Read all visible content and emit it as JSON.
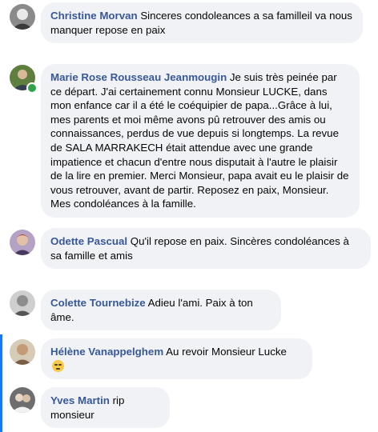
{
  "comments": [
    {
      "author": "Christine Morvan",
      "text": "Sinceres condoleances a sa familleil va nous manquer repose en paix",
      "online": false
    },
    {
      "author": "Marie Rose Rousseau Jeanmougin",
      "text": "Je suis très peinée par ce départ. J'ai certainement connu Monsieur LUCKE, dans mon enfance car il a été le coéquipier de papa...Grâce à lui, mes parents et moi même avons pû retrouver des amis ou connaissances, perdus de vue depuis si longtemps. La revue de SALA MARRAKECH était attendue avec une grande impatience et chacun d'entre nous disputait à l'autre le plaisir de la lire en premier. Merci Monsieur, papa avait eu le plaisir de vous retrouver, avant de partir. Reposez en paix, Monsieur. Mes condoléances à la famille.",
      "online": true
    },
    {
      "author": "Odette Pascual",
      "text": "Qu'il repose en paix. Sincères condoléances à sa famille et amis",
      "online": false
    },
    {
      "author": "Colette Tournebize",
      "text": "Adieu l'ami. Paix à ton âme.",
      "online": false
    },
    {
      "author": "Hélène Vanappelghem",
      "text": "Au revoir Monsieur Lucke",
      "emoji": "sad-face-emoji",
      "online": false,
      "highlighted": true
    },
    {
      "author": "Yves Martin",
      "text": "rip monsieur",
      "online": false
    }
  ],
  "colors": {
    "author_name": "#385898",
    "bubble_background": "#f0f2f5",
    "text": "#050505",
    "online_indicator": "#31a24c",
    "thread_highlight": "#1877f2"
  }
}
